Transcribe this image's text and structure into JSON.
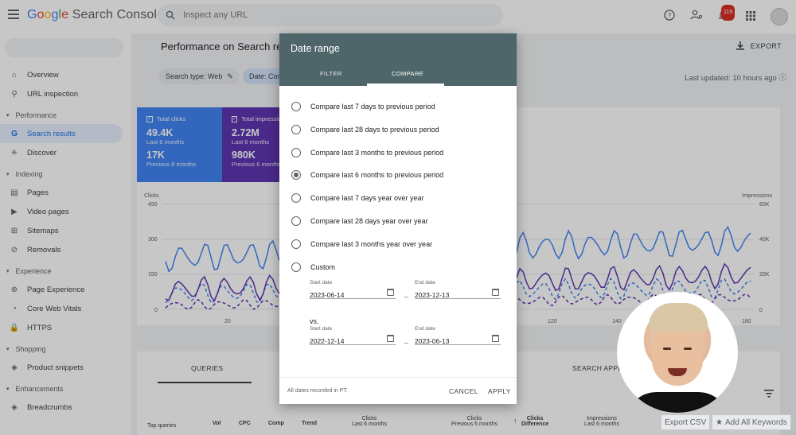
{
  "app": {
    "logo": {
      "g": "G",
      "o1": "o",
      "o2": "o",
      "g2": "g",
      "l": "l",
      "e": "e",
      "rest": " Search Console"
    },
    "search_placeholder": "Inspect any URL",
    "notifications_count": "119"
  },
  "sidebar": {
    "items_top": [
      {
        "label": "Overview",
        "icon": "home-icon"
      },
      {
        "label": "URL inspection",
        "icon": "search-icon"
      }
    ],
    "sections": [
      {
        "title": "Performance",
        "items": [
          {
            "label": "Search results",
            "icon": "google-g-icon",
            "active": true
          },
          {
            "label": "Discover",
            "icon": "asterisk-icon"
          }
        ]
      },
      {
        "title": "Indexing",
        "items": [
          {
            "label": "Pages",
            "icon": "pages-icon"
          },
          {
            "label": "Video pages",
            "icon": "video-icon"
          },
          {
            "label": "Sitemaps",
            "icon": "sitemap-icon"
          },
          {
            "label": "Removals",
            "icon": "removals-icon"
          }
        ]
      },
      {
        "title": "Experience",
        "items": [
          {
            "label": "Page Experience",
            "icon": "experience-icon"
          },
          {
            "label": "Core Web Vitals",
            "icon": "speed-icon"
          },
          {
            "label": "HTTPS",
            "icon": "lock-icon"
          }
        ]
      },
      {
        "title": "Shopping",
        "items": [
          {
            "label": "Product snippets",
            "icon": "layers-icon"
          }
        ]
      },
      {
        "title": "Enhancements",
        "items": [
          {
            "label": "Breadcrumbs",
            "icon": "layers-icon"
          }
        ]
      }
    ]
  },
  "main": {
    "title": "Performance on Search results",
    "export_label": "EXPORT",
    "chip_search_type": "Search type: Web",
    "chip_date": "Date: Compare",
    "last_updated": "Last updated: 10 hours ago",
    "cards": {
      "clicks": {
        "label": "Total clicks",
        "value": "49.4K",
        "period": "Last 6 months",
        "prev_value": "17K",
        "prev_period": "Previous 6 months"
      },
      "impressions": {
        "label": "Total impressions",
        "value": "2.72M",
        "period": "Last 6 months",
        "prev_value": "980K",
        "prev_period": "Previous 6 months"
      }
    },
    "chart": {
      "left_axis_title": "Clicks",
      "right_axis_title": "Impressions",
      "left_ticks": [
        "450",
        "300",
        "150",
        "0"
      ],
      "right_ticks": [
        "60K",
        "40K",
        "20K",
        "0"
      ],
      "x_ticks": [
        "20",
        "120",
        "140",
        "180"
      ]
    },
    "bottom": {
      "tab_queries": "QUERIES",
      "tab_search_appearance": "SEARCH APPEARANCE",
      "col_top_queries": "Top queries",
      "col_vol": "Vol",
      "col_cpc": "CPC",
      "col_comp": "Comp",
      "col_trend": "Trend",
      "col_clicks_last": "Clicks\nLast 6 months",
      "col_clicks_prev": "Clicks\nPrevious 6 months",
      "col_clicks_diff": "Clicks\nDifference",
      "col_impr_last": "Impressions\nLast 6 months"
    }
  },
  "dialog": {
    "title": "Date range",
    "tab_filter": "FILTER",
    "tab_compare": "COMPARE",
    "options": [
      {
        "label": "Compare last 7 days to previous period",
        "selected": false
      },
      {
        "label": "Compare last 28 days to previous period",
        "selected": false
      },
      {
        "label": "Compare last 3 months to previous period",
        "selected": false
      },
      {
        "label": "Compare last 6 months to previous period",
        "selected": true
      },
      {
        "label": "Compare last 7 days year over year",
        "selected": false
      },
      {
        "label": "Compare last 28 days year over year",
        "selected": false
      },
      {
        "label": "Compare last 3 months year over year",
        "selected": false
      },
      {
        "label": "Custom",
        "selected": false
      }
    ],
    "start_date_label": "Start date",
    "end_date_label": "End date",
    "start_date": "2023-06-14",
    "end_date": "2023-12-13",
    "vs_label": "vs.",
    "vs_start_date": "2022-12-14",
    "vs_end_date": "2023-06-13",
    "note": "All dates recorded in PT.",
    "cancel": "CANCEL",
    "apply": "APPLY"
  },
  "extension": {
    "export_csv": "Export CSV",
    "add_all_keywords": "Add All Keywords"
  },
  "colors": {
    "clicks": "#4285f4",
    "impressions": "#5e35b1",
    "dialog_header": "#4e6669"
  }
}
